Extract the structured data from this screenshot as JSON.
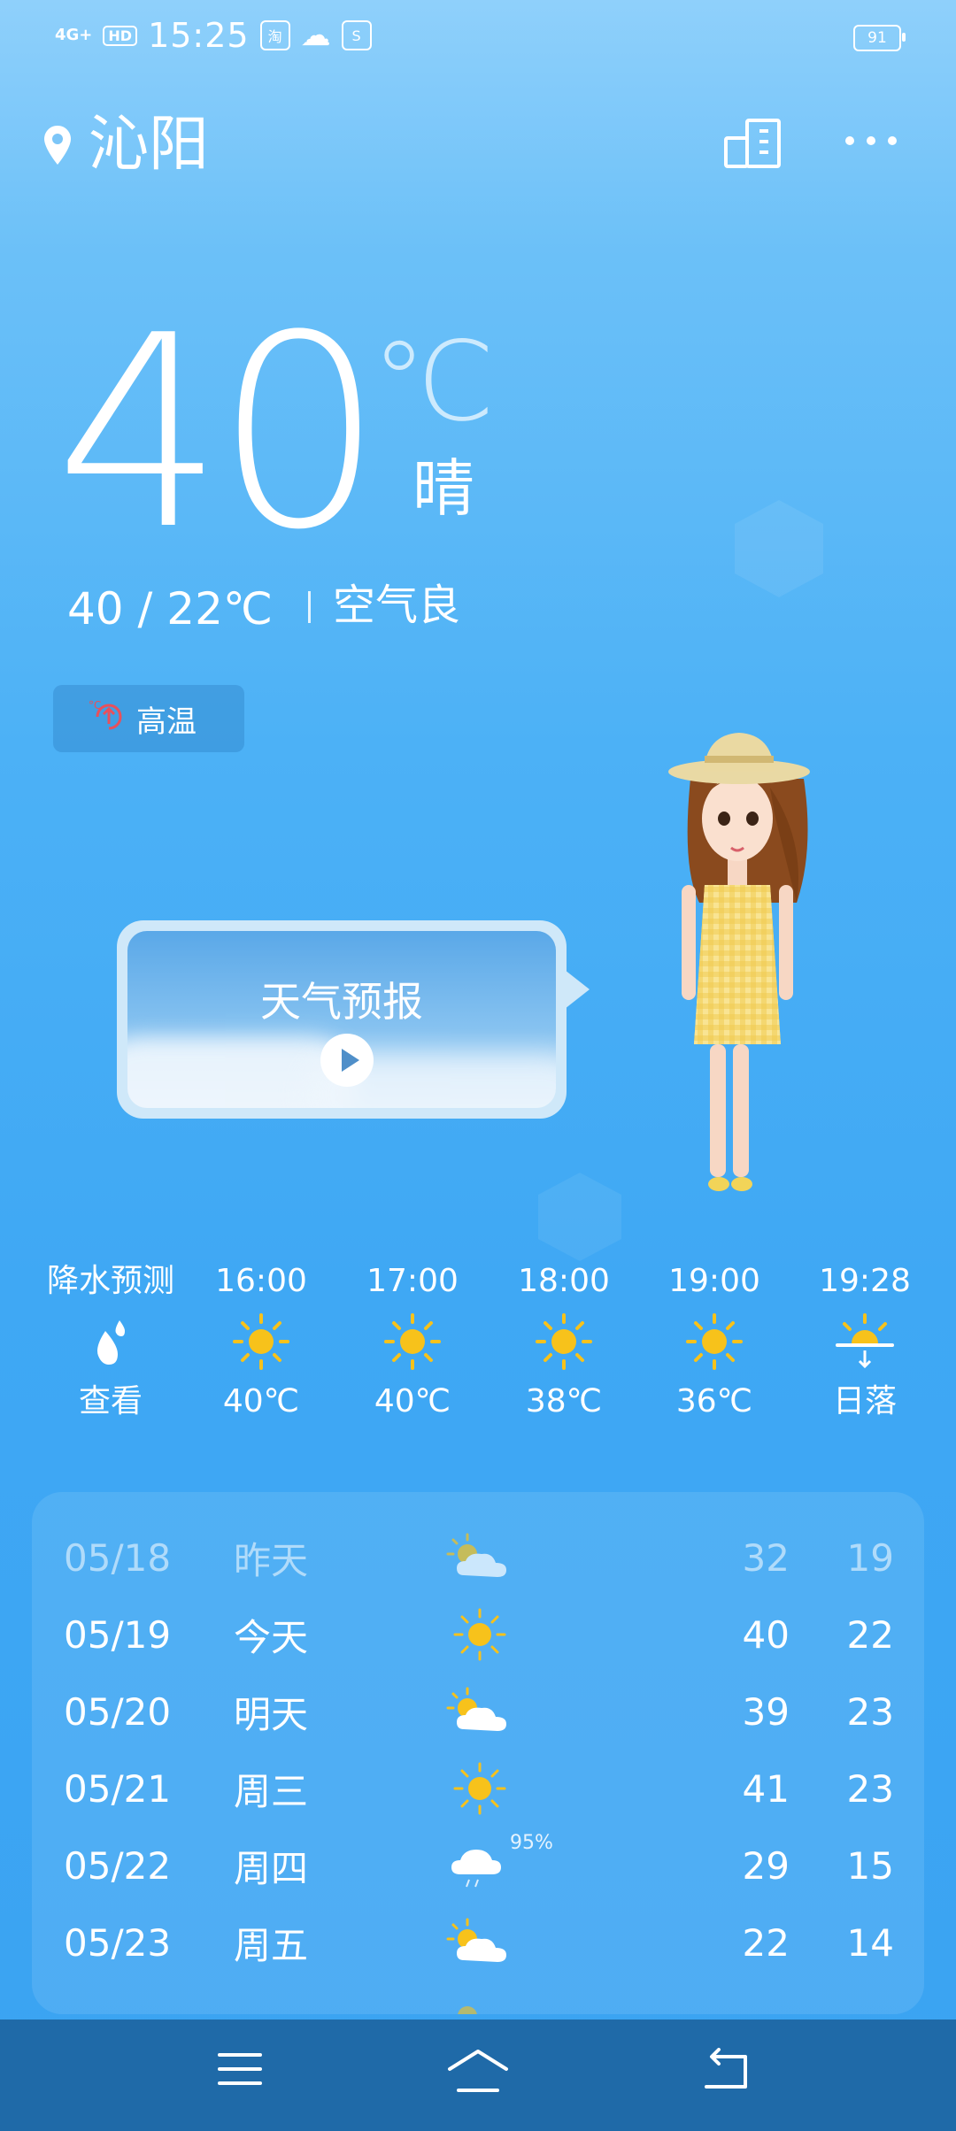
{
  "status_bar": {
    "network": "4G+",
    "hd": "HD",
    "time": "15:25",
    "app_badges": [
      "淘",
      "☁",
      "S"
    ],
    "battery": "91"
  },
  "header": {
    "city": "沁阳",
    "city_manage_icon": "city-buildings-icon",
    "more_icon": "more-dots-icon"
  },
  "current": {
    "temperature": "40",
    "unit": "℃",
    "condition": "晴",
    "high_low": "40  /  22℃",
    "air_quality": "空气良",
    "alert": "高温"
  },
  "forecast_card": {
    "title": "天气预报"
  },
  "hourly": [
    {
      "time": "降水预测",
      "icon": "raindrop-icon",
      "value": "查看"
    },
    {
      "time": "16:00",
      "icon": "sun-icon",
      "value": "40℃"
    },
    {
      "time": "17:00",
      "icon": "sun-icon",
      "value": "40℃"
    },
    {
      "time": "18:00",
      "icon": "sun-icon",
      "value": "38℃"
    },
    {
      "time": "19:00",
      "icon": "sun-icon",
      "value": "36℃"
    },
    {
      "time": "19:28",
      "icon": "sunset-icon",
      "value": "日落"
    }
  ],
  "daily": [
    {
      "date": "05/18",
      "day": "昨天",
      "icon": "partly-cloudy-icon",
      "high": "32",
      "low": "19",
      "precip": ""
    },
    {
      "date": "05/19",
      "day": "今天",
      "icon": "sun-icon",
      "high": "40",
      "low": "22",
      "precip": ""
    },
    {
      "date": "05/20",
      "day": "明天",
      "icon": "partly-cloudy-icon",
      "high": "39",
      "low": "23",
      "precip": ""
    },
    {
      "date": "05/21",
      "day": "周三",
      "icon": "sun-icon",
      "high": "41",
      "low": "23",
      "precip": ""
    },
    {
      "date": "05/22",
      "day": "周四",
      "icon": "rain-cloud-icon",
      "high": "29",
      "low": "15",
      "precip": "95%"
    },
    {
      "date": "05/23",
      "day": "周五",
      "icon": "partly-cloudy-icon",
      "high": "22",
      "low": "14",
      "precip": ""
    }
  ],
  "colors": {
    "sun": "#f7c21b",
    "alert_icon": "#e8505b",
    "navbar": "#1f6aa8"
  }
}
